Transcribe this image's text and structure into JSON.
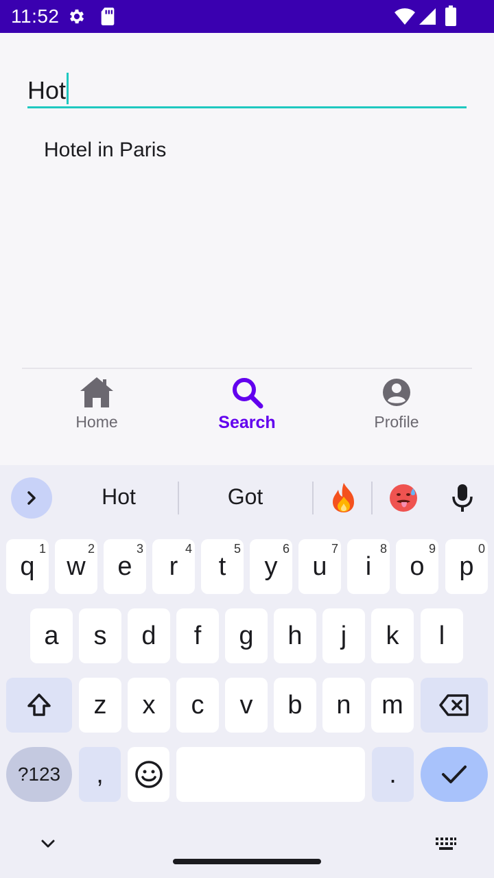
{
  "status_bar": {
    "time": "11:52",
    "icons": [
      "gear-icon",
      "sd-card-icon",
      "wifi-icon",
      "signal-icon",
      "battery-icon"
    ]
  },
  "search": {
    "value": "Hot",
    "accent_color": "#1fc8c0"
  },
  "suggestions": [
    "Hotel in Paris"
  ],
  "bottom_nav": {
    "items": [
      {
        "label": "Home",
        "icon": "home-icon",
        "active": false
      },
      {
        "label": "Search",
        "icon": "search-icon",
        "active": true
      },
      {
        "label": "Profile",
        "icon": "account-circle-icon",
        "active": false
      }
    ],
    "active_color": "#6200ee"
  },
  "keyboard": {
    "suggestions": [
      "Hot",
      "Got"
    ],
    "emoji_suggestions": [
      "fire-emoji",
      "hot-face-emoji"
    ],
    "row1": [
      {
        "key": "q",
        "hint": "1"
      },
      {
        "key": "w",
        "hint": "2"
      },
      {
        "key": "e",
        "hint": "3"
      },
      {
        "key": "r",
        "hint": "4"
      },
      {
        "key": "t",
        "hint": "5"
      },
      {
        "key": "y",
        "hint": "6"
      },
      {
        "key": "u",
        "hint": "7"
      },
      {
        "key": "i",
        "hint": "8"
      },
      {
        "key": "o",
        "hint": "9"
      },
      {
        "key": "p",
        "hint": "0"
      }
    ],
    "row2": [
      "a",
      "s",
      "d",
      "f",
      "g",
      "h",
      "j",
      "k",
      "l"
    ],
    "row3": [
      "z",
      "x",
      "c",
      "v",
      "b",
      "n",
      "m"
    ],
    "symbols_label": "?123",
    "comma_label": ",",
    "period_label": "."
  }
}
